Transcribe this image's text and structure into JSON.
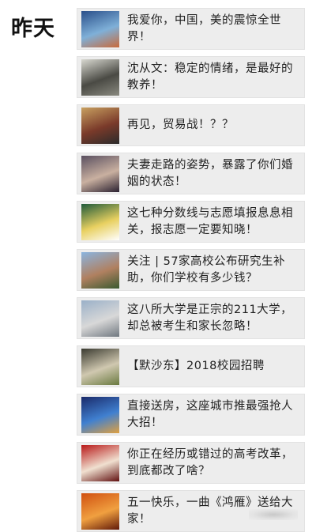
{
  "section": {
    "heading": "昨天"
  },
  "articles": [
    {
      "title": "我爱你，中国，美的震惊全世界！",
      "thumb": "landscape-mountain-photo",
      "colors": [
        "#2a4f8a",
        "#7fb0d8",
        "#c96a3a"
      ]
    },
    {
      "title": "沈从文：稳定的情绪，是最好的教养！",
      "thumb": "old-couple-photo",
      "colors": [
        "#d8d8d0",
        "#4a4a44",
        "#8a8a80"
      ]
    },
    {
      "title": "再见，贸易战！？？",
      "thumb": "politician-portrait-photo",
      "colors": [
        "#c8a060",
        "#7a3a2a",
        "#2b2b2b"
      ]
    },
    {
      "title": "夫妻走路的姿势，暴露了你们婚姻的状态！",
      "thumb": "couple-walking-photo",
      "colors": [
        "#5a5060",
        "#c9b0a0",
        "#2a2030"
      ]
    },
    {
      "title": "这七种分数线与志愿填报息息相关，报志愿一定要知晓！",
      "thumb": "chalkboard-photo",
      "colors": [
        "#1f5a3a",
        "#e8d060",
        "#ffffff"
      ]
    },
    {
      "title": "关注 | 57家高校公布研究生补助，你们学校有多少钱？",
      "thumb": "university-building-photo",
      "colors": [
        "#8ab4e0",
        "#b08060",
        "#3a5a30"
      ]
    },
    {
      "title": "这八所大学是正宗的211大学，却总被考生和家长忽略！",
      "thumb": "campus-building-photo",
      "colors": [
        "#9ab0c8",
        "#d8d8d8",
        "#707880"
      ]
    },
    {
      "title": "【默沙东】2018校园招聘",
      "thumb": "company-logo-photo",
      "colors": [
        "#3a3a30",
        "#d0c8b0",
        "#6a7a40"
      ]
    },
    {
      "title": "直接送房，这座城市推最强抢人大招！",
      "thumb": "city-night-photo",
      "colors": [
        "#1a2a6a",
        "#4080d0",
        "#e0a040"
      ]
    },
    {
      "title": "你正在经历或错过的高考改革，到底都改了啥？",
      "thumb": "raised-fist-poster",
      "colors": [
        "#b81818",
        "#f0e0d0",
        "#601010"
      ]
    },
    {
      "title": "五一快乐，一曲《鸿雁》送给大家！",
      "thumb": "sunset-photo",
      "colors": [
        "#d05010",
        "#f0a040",
        "#601808"
      ]
    }
  ]
}
